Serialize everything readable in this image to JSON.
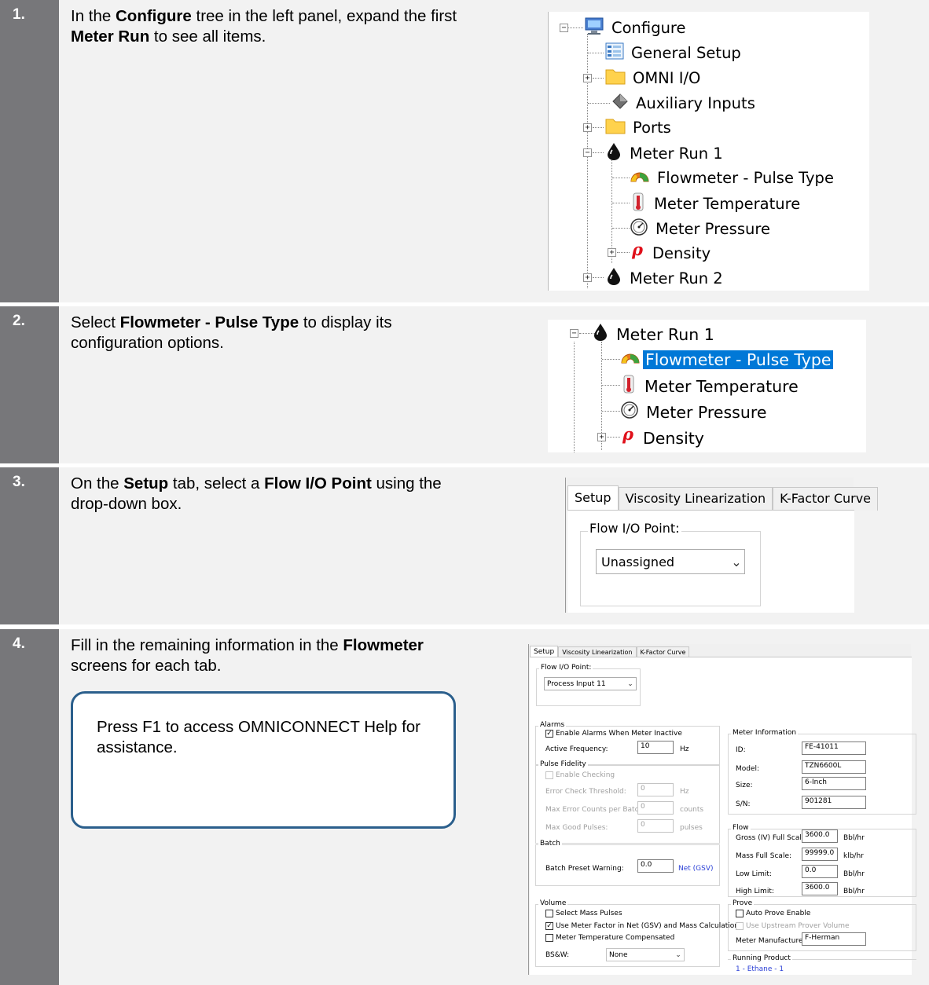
{
  "steps": [
    {
      "num": "1.",
      "parts": [
        {
          "t": "In the ",
          "b": false
        },
        {
          "t": "Configure",
          "b": true
        },
        {
          "t": " tree in the left panel, expand the first ",
          "b": false
        },
        {
          "t": "Meter Run",
          "b": true
        },
        {
          "t": " to see all items.",
          "b": false
        }
      ]
    },
    {
      "num": "2.",
      "parts": [
        {
          "t": "Select ",
          "b": false
        },
        {
          "t": "Flowmeter - Pulse Type",
          "b": true
        },
        {
          "t": " to display its configuration options.",
          "b": false
        }
      ]
    },
    {
      "num": "3.",
      "parts": [
        {
          "t": "On the ",
          "b": false
        },
        {
          "t": "Setup",
          "b": true
        },
        {
          "t": " tab, select a ",
          "b": false
        },
        {
          "t": "Flow I/O Point",
          "b": true
        },
        {
          "t": " using the drop-down box.",
          "b": false
        }
      ]
    },
    {
      "num": "4.",
      "parts": [
        {
          "t": "Fill in the remaining information in the ",
          "b": false
        },
        {
          "t": "Flowmeter",
          "b": true
        },
        {
          "t": " screens for each tab.",
          "b": false
        }
      ]
    }
  ],
  "callout": "Press F1 to access OMNICONNECT Help for assistance.",
  "tree1": {
    "configure": "Configure",
    "general_setup": "General Setup",
    "omni_io": "OMNI I/O",
    "aux_inputs": "Auxiliary Inputs",
    "ports": "Ports",
    "meter_run_1": "Meter Run 1",
    "flowmeter": "Flowmeter - Pulse Type",
    "meter_temp": "Meter Temperature",
    "meter_pressure": "Meter Pressure",
    "density": "Density",
    "meter_run_2": "Meter Run 2"
  },
  "tree2": {
    "meter_run_1": "Meter Run 1",
    "flowmeter": "Flowmeter - Pulse Type",
    "meter_temp": "Meter Temperature",
    "meter_pressure": "Meter Pressure",
    "density": "Density"
  },
  "tabs": {
    "setup": "Setup",
    "viscosity": "Viscosity Linearization",
    "kfactor": "K-Factor Curve"
  },
  "step3": {
    "flow_io_label": "Flow I/O Point:",
    "flow_io_value": "Unassigned"
  },
  "form": {
    "flow_io_label": "Flow I/O Point:",
    "flow_io_value": "Process Input 11",
    "alarms": {
      "title": "Alarms",
      "enable_label": "Enable Alarms When Meter Inactive",
      "enable_checked": true,
      "active_freq_label": "Active Frequency:",
      "active_freq_value": "10",
      "active_freq_unit": "Hz"
    },
    "pulse_fidelity": {
      "title": "Pulse Fidelity",
      "enable_label": "Enable Checking",
      "threshold_label": "Error Check Threshold:",
      "threshold_value": "0",
      "threshold_unit": "Hz",
      "max_err_label": "Max Error Counts per Batch:",
      "max_err_value": "0",
      "max_err_unit": "counts",
      "max_good_label": "Max Good Pulses:",
      "max_good_value": "0",
      "max_good_unit": "pulses"
    },
    "batch": {
      "title": "Batch",
      "preset_label": "Batch Preset Warning:",
      "preset_value": "0.0",
      "preset_unit": "Net (GSV)"
    },
    "volume": {
      "title": "Volume",
      "mass_pulses": "Select Mass Pulses",
      "use_factor": "Use Meter Factor in Net (GSV) and Mass Calculations",
      "temp_comp": "Meter Temperature Compensated",
      "bsw_label": "BS&W:",
      "bsw_value": "None"
    },
    "meter_info": {
      "title": "Meter Information",
      "id_label": "ID:",
      "id_value": "FE-41011",
      "model_label": "Model:",
      "model_value": "TZN6600L",
      "size_label": "Size:",
      "size_value": "6-Inch",
      "sn_label": "S/N:",
      "sn_value": "901281"
    },
    "flow": {
      "title": "Flow",
      "gross_label": "Gross (IV) Full Scale:",
      "gross_value": "3600.0",
      "gross_unit": "Bbl/hr",
      "mass_label": "Mass Full Scale:",
      "mass_value": "99999.0",
      "mass_unit": "klb/hr",
      "low_label": "Low Limit:",
      "low_value": "0.0",
      "low_unit": "Bbl/hr",
      "high_label": "High Limit:",
      "high_value": "3600.0",
      "high_unit": "Bbl/hr"
    },
    "prove": {
      "title": "Prove",
      "auto_prove": "Auto Prove Enable",
      "upstream": "Use Upstream Prover Volume",
      "mfr_label": "Meter Manufacturer:",
      "mfr_value": "F-Herman"
    },
    "running_product": {
      "title": "Running Product",
      "value": "1 - Ethane - 1"
    }
  }
}
